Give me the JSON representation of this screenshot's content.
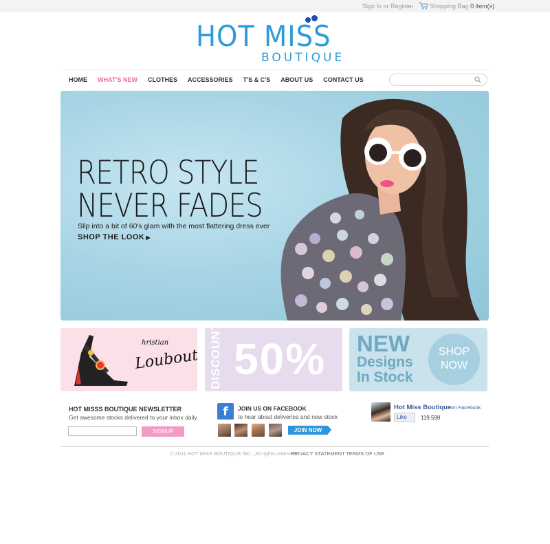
{
  "topbar": {
    "signin": "Sign In or Register",
    "bag_label": "Shopping Bag",
    "bag_count": "0 item(s)"
  },
  "brand": {
    "name": "HOT MISS",
    "tagline": "BOUTIQUE",
    "color": "#2f9ad8",
    "dot_color": "#1d4fb3"
  },
  "nav": {
    "items": [
      {
        "label": "HOME"
      },
      {
        "label": "WHAT'S NEW",
        "active": true
      },
      {
        "label": "CLOTHES"
      },
      {
        "label": "ACCESSORIES"
      },
      {
        "label": "T'S & C'S"
      },
      {
        "label": "ABOUT US"
      },
      {
        "label": "CONTACT US"
      }
    ],
    "active_color": "#ef6aa7",
    "search_placeholder": "",
    "search_icon": "search-icon"
  },
  "hero": {
    "line1": "RETRO STYLE",
    "line2": "NEVER FADES",
    "subtitle": "Slip into a bit of 60's glam with the most flattering dress ever",
    "cta": "SHOP THE LOOK",
    "cta_arrow": "▶"
  },
  "promos": {
    "louboutin_line1": "hristian",
    "louboutin_line2": "Louboutin",
    "discount_label": "DISCOUNT",
    "discount_value": "50%",
    "new_line1": "NEW",
    "new_line2": "Designs",
    "new_line3": "In Stock",
    "shop_line1": "SHOP",
    "shop_line2": "NOW"
  },
  "newsletter": {
    "title": "HOT MISSS BOUTIQUE NEWSLETTER",
    "subtitle": "Get awesome stocks delivered to your inbox daily",
    "input_value": "",
    "button": "SIGNUP",
    "button_color": "#f49bc5"
  },
  "facebook": {
    "logo": "f",
    "title": "JOIN US ON FACEBOOK",
    "subtitle": "to hear about deliveries and new stock",
    "join_button": "JOIN NOW",
    "widget_name": "Hot Miss Boutique",
    "widget_on": "on Facebook",
    "like_label": "Like",
    "like_count": "119,598"
  },
  "footer": {
    "copyright": "© 2011 HOT MISS BOUTIQUE INC., All rights reserved.",
    "privacy": "PRIVACY STATEMENT",
    "terms": "TERMS OF USE"
  }
}
